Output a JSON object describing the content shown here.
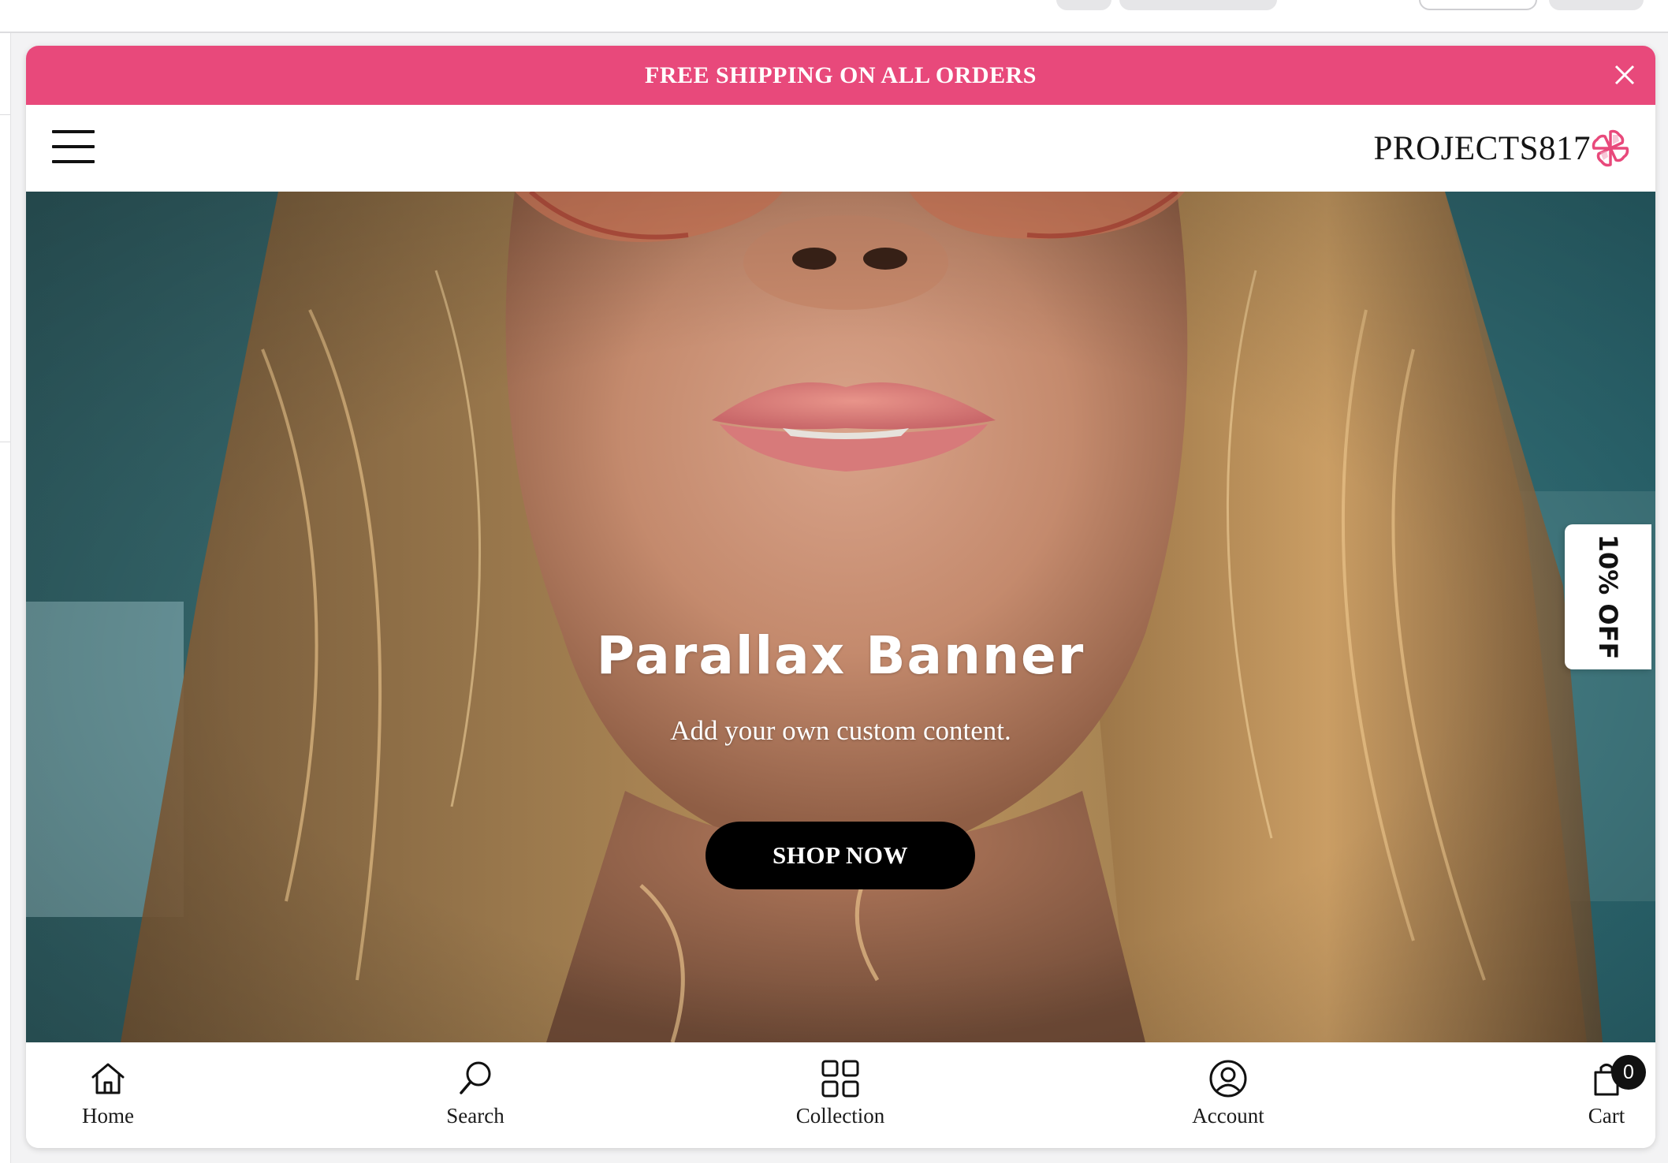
{
  "announcement": {
    "text": "FREE SHIPPING ON ALL ORDERS",
    "background": "#e8497b"
  },
  "header": {
    "logo_text": "PROJECTS817"
  },
  "hero": {
    "title": "Parallax Banner",
    "subtitle": "Add your own custom content.",
    "cta_label": "SHOP NOW"
  },
  "discount_tab": {
    "label": "10% OFF"
  },
  "bottom_nav": {
    "items": [
      {
        "label": "Home",
        "icon": "home-icon"
      },
      {
        "label": "Search",
        "icon": "search-icon"
      },
      {
        "label": "Collection",
        "icon": "grid-icon"
      },
      {
        "label": "Account",
        "icon": "account-icon"
      },
      {
        "label": "Cart",
        "icon": "cart-icon"
      }
    ],
    "cart_count": "0"
  }
}
